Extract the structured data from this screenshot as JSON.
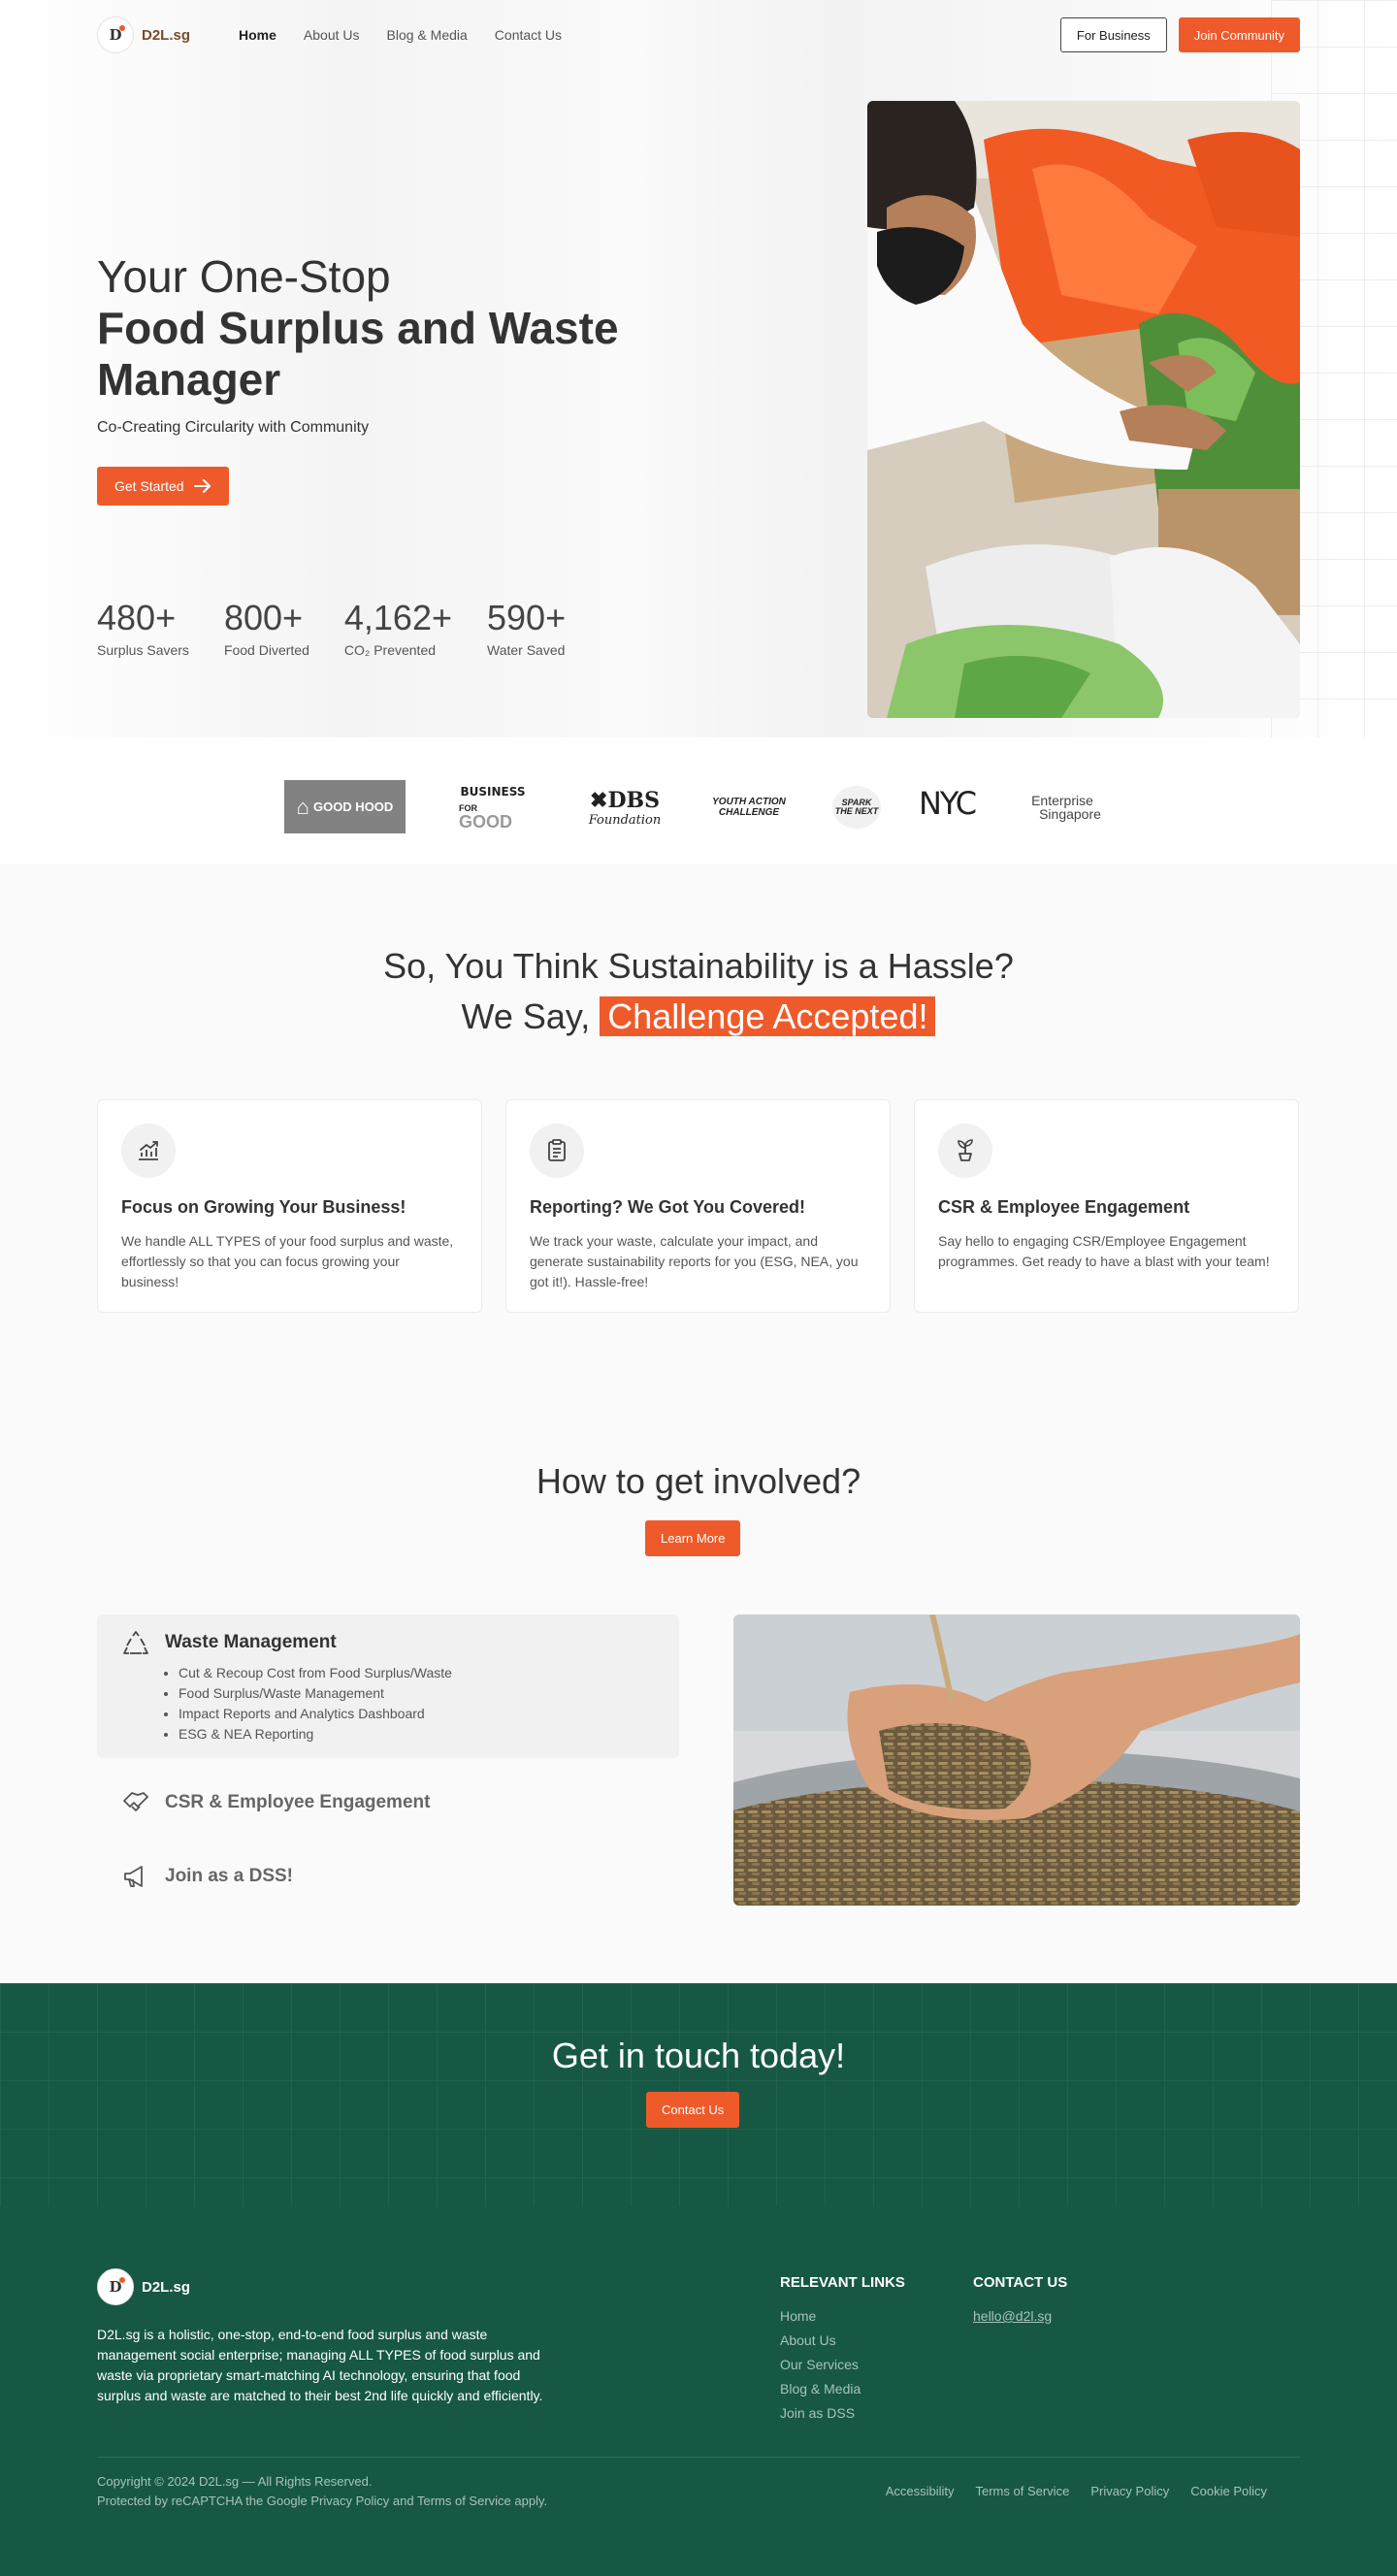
{
  "nav": {
    "logo_text": "D2L.sg",
    "links": [
      "Home",
      "About Us",
      "Blog & Media",
      "Contact Us"
    ],
    "for_business": "For Business",
    "join_community": "Join Community"
  },
  "hero": {
    "line1": "Your One-Stop",
    "line2a": "Food Surplus and Waste",
    "line2b": "Manager",
    "subtitle": "Co-Creating Circularity with Community",
    "cta": "Get Started",
    "stats": [
      {
        "value": "480+",
        "label": "Surplus Savers"
      },
      {
        "value": "800+",
        "label": "Food Diverted"
      },
      {
        "value": "4,162+",
        "label": "CO₂ Prevented"
      },
      {
        "value": "590+",
        "label": "Water Saved"
      }
    ]
  },
  "partners": {
    "goodhood": "GOOD HOOD",
    "business": "BUSINESS",
    "for": "FOR",
    "good": "GOOD",
    "dbs": "DBS",
    "foundation": "Foundation",
    "youth": "YOUTH ACTION",
    "challenge": "CHALLENGE",
    "spark": "SPARK",
    "the_next": "THE NEXT",
    "nyc": "NYC",
    "enterprise": "Enterprise",
    "singapore": "Singapore"
  },
  "challenge": {
    "line1": "So, You Think Sustainability is a Hassle?",
    "line2_prefix": "We Say,",
    "line2_highlight": "Challenge Accepted!",
    "cards": [
      {
        "title": "Focus on Growing Your Business!",
        "desc": "We handle ALL TYPES of your food surplus and waste, effortlessly so that you can focus growing your business!",
        "icon": "growth-chart-icon"
      },
      {
        "title": "Reporting? We Got You Covered!",
        "desc": "We track your waste, calculate your impact, and generate sustainability reports for you (ESG, NEA, you got it!). Hassle-free!",
        "icon": "clipboard-icon"
      },
      {
        "title": "CSR & Employee Engagement",
        "desc": "Say hello to engaging CSR/Employee Engagement programmes. Get ready to have a blast with your team!",
        "icon": "plant-pot-icon"
      }
    ]
  },
  "involved": {
    "title": "How to get involved?",
    "learn_more": "Learn More",
    "items": [
      {
        "title": "Waste Management",
        "icon": "recycle-icon",
        "bullets": [
          "Cut & Recoup Cost from Food Surplus/Waste",
          "Food Surplus/Waste Management",
          "Impact Reports and Analytics Dashboard",
          "ESG & NEA Reporting"
        ]
      },
      {
        "title": "CSR & Employee Engagement",
        "icon": "handshake-icon"
      },
      {
        "title": "Join as a DSS!",
        "icon": "megaphone-icon"
      }
    ]
  },
  "footer": {
    "touch_title": "Get in touch today!",
    "contact_btn": "Contact Us",
    "logo_text": "D2L.sg",
    "description": "D2L.sg is a holistic, one-stop, end-to-end food surplus and waste management social enterprise; managing ALL TYPES of food surplus and waste via proprietary smart-matching AI technology, ensuring that food surplus and waste are matched to their best 2nd life quickly and efficiently.",
    "relevant_links_title": "RELEVANT LINKS",
    "relevant_links": [
      "Home",
      "About Us",
      "Our Services",
      "Blog & Media",
      "Join as DSS"
    ],
    "contact_title": "CONTACT US",
    "email": "hello@d2l.sg",
    "copyright": "Copyright © 2024 D2L.sg — All Rights Reserved.",
    "recaptcha": "Protected by reCAPTCHA the Google Privacy Policy and Terms of Service apply.",
    "legal": [
      "Accessibility",
      "Terms of Service",
      "Privacy Policy",
      "Cookie Policy"
    ]
  },
  "colors": {
    "accent": "#ef5a2b",
    "footer_bg": "#165844",
    "text": "#2f2f2f"
  }
}
